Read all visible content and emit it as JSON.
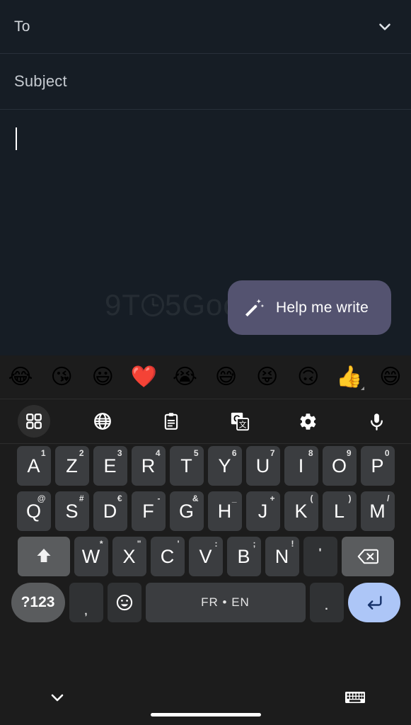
{
  "compose": {
    "to_label": "To",
    "expand_icon": "chevron-down-icon",
    "subject_label": "Subject",
    "body_text": "",
    "watermark_prefix": "9T",
    "watermark_suffix": "5Google",
    "help_me_write": {
      "label": "Help me write",
      "icon": "magic-wand-icon",
      "bg_color": "#545370"
    }
  },
  "keyboard": {
    "emoji_row": [
      {
        "glyph": "😂",
        "name": "face-with-tears-of-joy",
        "variant": false
      },
      {
        "glyph": "😘",
        "name": "face-blowing-a-kiss",
        "variant": false
      },
      {
        "glyph": "😃",
        "name": "grinning-face-with-big-eyes",
        "variant": false
      },
      {
        "glyph": "❤️",
        "name": "red-heart",
        "variant": false
      },
      {
        "glyph": "😭",
        "name": "loudly-crying-face",
        "variant": false
      },
      {
        "glyph": "😅",
        "name": "grinning-face-with-sweat",
        "variant": false
      },
      {
        "glyph": "😝",
        "name": "squinting-face-with-tongue",
        "variant": false
      },
      {
        "glyph": "🙃",
        "name": "upside-down-face",
        "variant": false
      },
      {
        "glyph": "👍",
        "name": "thumbs-up",
        "variant": true
      },
      {
        "glyph": "😄",
        "name": "grinning-face-with-smiling-eyes",
        "variant": false
      }
    ],
    "toolbar": [
      {
        "name": "apps-grid-icon",
        "active": true
      },
      {
        "name": "globe-icon",
        "active": false
      },
      {
        "name": "clipboard-icon",
        "active": false
      },
      {
        "name": "translate-icon",
        "active": false
      },
      {
        "name": "settings-gear-icon",
        "active": false
      },
      {
        "name": "microphone-icon",
        "active": false
      }
    ],
    "row1": [
      {
        "main": "A",
        "sup": "1"
      },
      {
        "main": "Z",
        "sup": "2"
      },
      {
        "main": "E",
        "sup": "3"
      },
      {
        "main": "R",
        "sup": "4"
      },
      {
        "main": "T",
        "sup": "5"
      },
      {
        "main": "Y",
        "sup": "6"
      },
      {
        "main": "U",
        "sup": "7"
      },
      {
        "main": "I",
        "sup": "8"
      },
      {
        "main": "O",
        "sup": "9"
      },
      {
        "main": "P",
        "sup": "0"
      }
    ],
    "row2": [
      {
        "main": "Q",
        "sup": "@"
      },
      {
        "main": "S",
        "sup": "#"
      },
      {
        "main": "D",
        "sup": "€"
      },
      {
        "main": "F",
        "sup": "-"
      },
      {
        "main": "G",
        "sup": "&"
      },
      {
        "main": "H",
        "sup": "_"
      },
      {
        "main": "J",
        "sup": "+"
      },
      {
        "main": "K",
        "sup": "("
      },
      {
        "main": "L",
        "sup": ")"
      },
      {
        "main": "M",
        "sup": "/"
      }
    ],
    "row3": [
      {
        "main": "W",
        "sup": "*"
      },
      {
        "main": "X",
        "sup": "\""
      },
      {
        "main": "C",
        "sup": "'"
      },
      {
        "main": "V",
        "sup": ":"
      },
      {
        "main": "B",
        "sup": ";"
      },
      {
        "main": "N",
        "sup": "!"
      }
    ],
    "shift_key": "shift-icon",
    "apostrophe_key": "'",
    "backspace_key": "backspace-icon",
    "row4": {
      "symbols_label": "?123",
      "comma_label": ",",
      "emoji_key": "emoji-smiley-icon",
      "space_label": "FR • EN",
      "period_label": ".",
      "enter_key": "enter-icon",
      "enter_color": "#adc6f7"
    }
  },
  "navbar": {
    "hide_keyboard_icon": "chevron-down-icon",
    "keyboard_switch_icon": "keyboard-icon",
    "home_indicator": "home-pill"
  }
}
